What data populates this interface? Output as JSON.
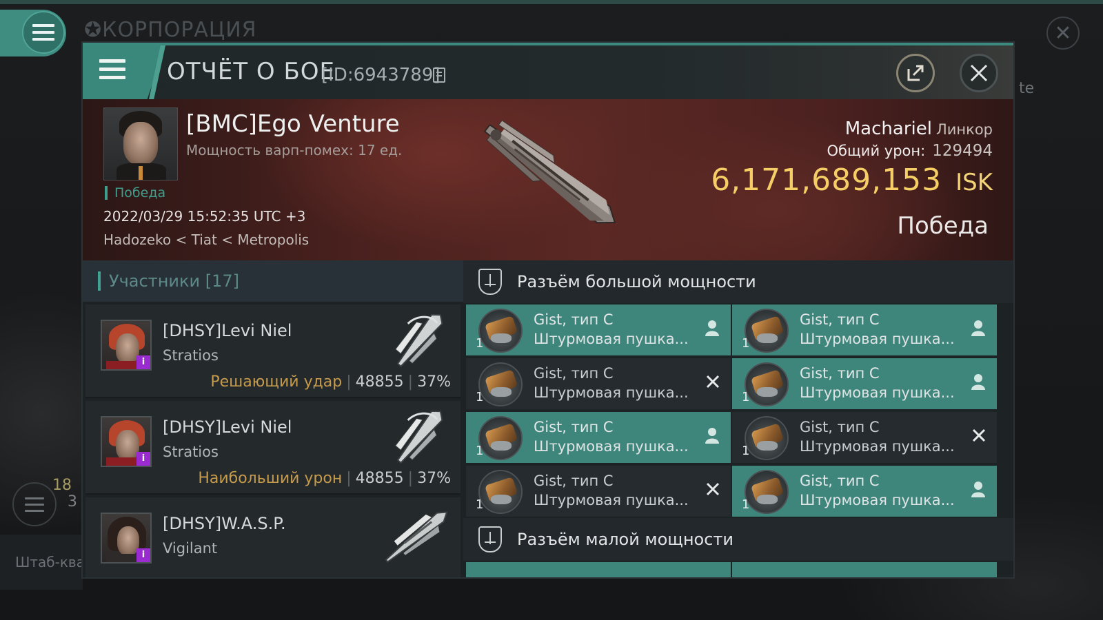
{
  "background": {
    "corp_title": "КОРПОРАЦИЯ",
    "side_text": "te",
    "counter_top": "18",
    "counter_bottom": "3",
    "hq_label": "Штаб-ква"
  },
  "header": {
    "title": "ОТЧЁТ О БОЕ",
    "battle_id": "[ID:6943789]",
    "share_icon": "share-icon",
    "close_icon": "close-icon"
  },
  "victim": {
    "name": "[BMC]Ego Venture",
    "warp_disrupt": "Мощность варп-помех: 17 ед.",
    "status_tag": "Победа",
    "datetime": "2022/03/29 15:52:35 UTC +3",
    "location": "Hadozeko < Tiat < Metropolis",
    "ship_name": "Machariel",
    "ship_class": "Линкор",
    "damage_label": "Общий урон:",
    "damage_value": "129494",
    "isk_amount": "6,171,689,153",
    "isk_unit": "ISK",
    "result": "Победа"
  },
  "participants": {
    "header": "Участники [17]",
    "rows": [
      {
        "name": "[DHSY]Levi Niel",
        "ship": "Stratios",
        "tag": "Решающий удар",
        "damage": "48855",
        "percent": "37%",
        "badge": "i"
      },
      {
        "name": "[DHSY]Levi Niel",
        "ship": "Stratios",
        "tag": "Наибольший урон",
        "damage": "48855",
        "percent": "37%",
        "badge": "i"
      },
      {
        "name": "[DHSY]W.A.S.P.",
        "ship": "Vigilant",
        "tag": "",
        "damage": "",
        "percent": "",
        "badge": "i"
      }
    ]
  },
  "modules": {
    "high_slot_label": "Разъём большой мощности",
    "low_slot_label": "Разъём малой мощности",
    "items": [
      {
        "qty": "1",
        "name": "Gist, тип C",
        "type": "Штурмовая пушка...",
        "state": "dropped"
      },
      {
        "qty": "1",
        "name": "Gist, тип C",
        "type": "Штурмовая пушка...",
        "state": "dropped"
      },
      {
        "qty": "1",
        "name": "Gist, тип C",
        "type": "Штурмовая пушка...",
        "state": "destroyed"
      },
      {
        "qty": "1",
        "name": "Gist, тип C",
        "type": "Штурмовая пушка...",
        "state": "dropped"
      },
      {
        "qty": "1",
        "name": "Gist, тип C",
        "type": "Штурмовая пушка...",
        "state": "dropped"
      },
      {
        "qty": "1",
        "name": "Gist, тип C",
        "type": "Штурмовая пушка...",
        "state": "destroyed"
      },
      {
        "qty": "1",
        "name": "Gist, тип C",
        "type": "Штурмовая пушка...",
        "state": "destroyed"
      },
      {
        "qty": "1",
        "name": "Gist, тип C",
        "type": "Штурмовая пушка...",
        "state": "dropped"
      }
    ]
  },
  "colors": {
    "accent_teal": "#3e867c",
    "isk_gold": "#f5cf66",
    "tag_gold": "#c79b4c",
    "badge_purple": "#9a2bd0"
  }
}
